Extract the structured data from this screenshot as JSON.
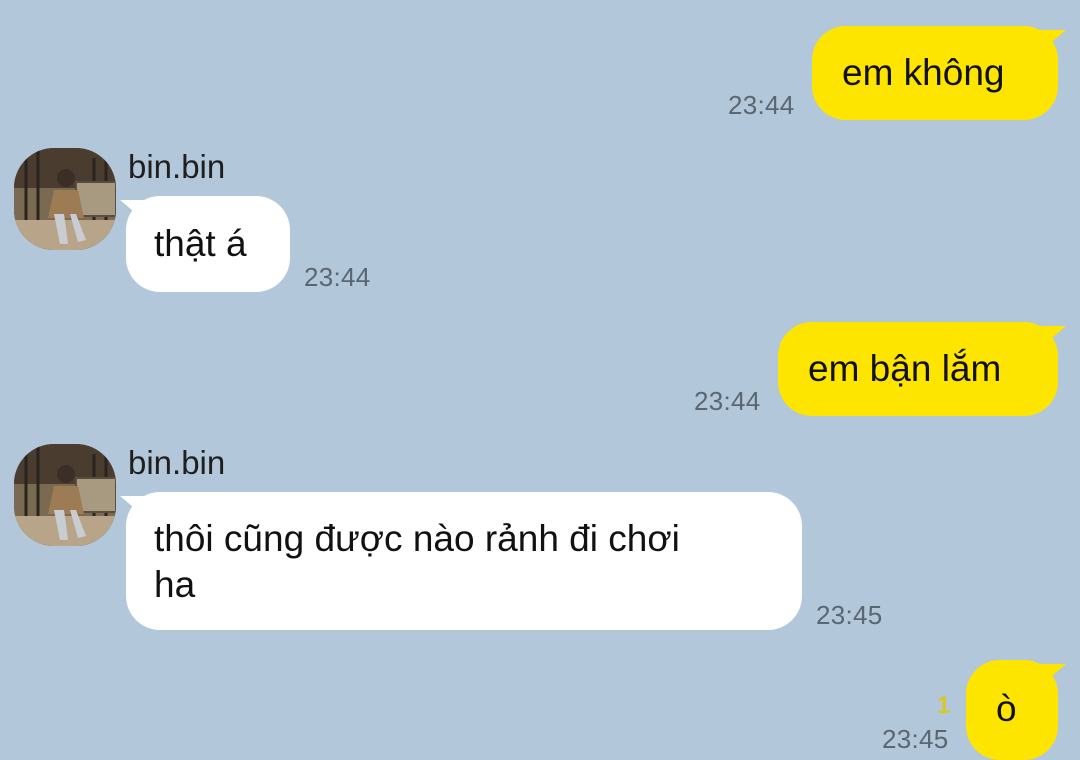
{
  "chat": {
    "messages": [
      {
        "direction": "out",
        "text": "em không",
        "time": "23:44"
      },
      {
        "direction": "in",
        "sender": "bin.bin",
        "text": "thật á",
        "time": "23:44"
      },
      {
        "direction": "out",
        "text": "em bận lắm",
        "time": "23:44"
      },
      {
        "direction": "in",
        "sender": "bin.bin",
        "text_line1": "thôi cũng được nào rảnh đi chơi",
        "text_line2": "ha",
        "time": "23:45"
      },
      {
        "direction": "out",
        "text": "ò",
        "time": "23:45",
        "unread_count": "1"
      }
    ]
  },
  "colors": {
    "background": "#b2c7d9",
    "outgoing_bubble": "#fee500",
    "incoming_bubble": "#ffffff",
    "unread_count": "#d8c826"
  }
}
